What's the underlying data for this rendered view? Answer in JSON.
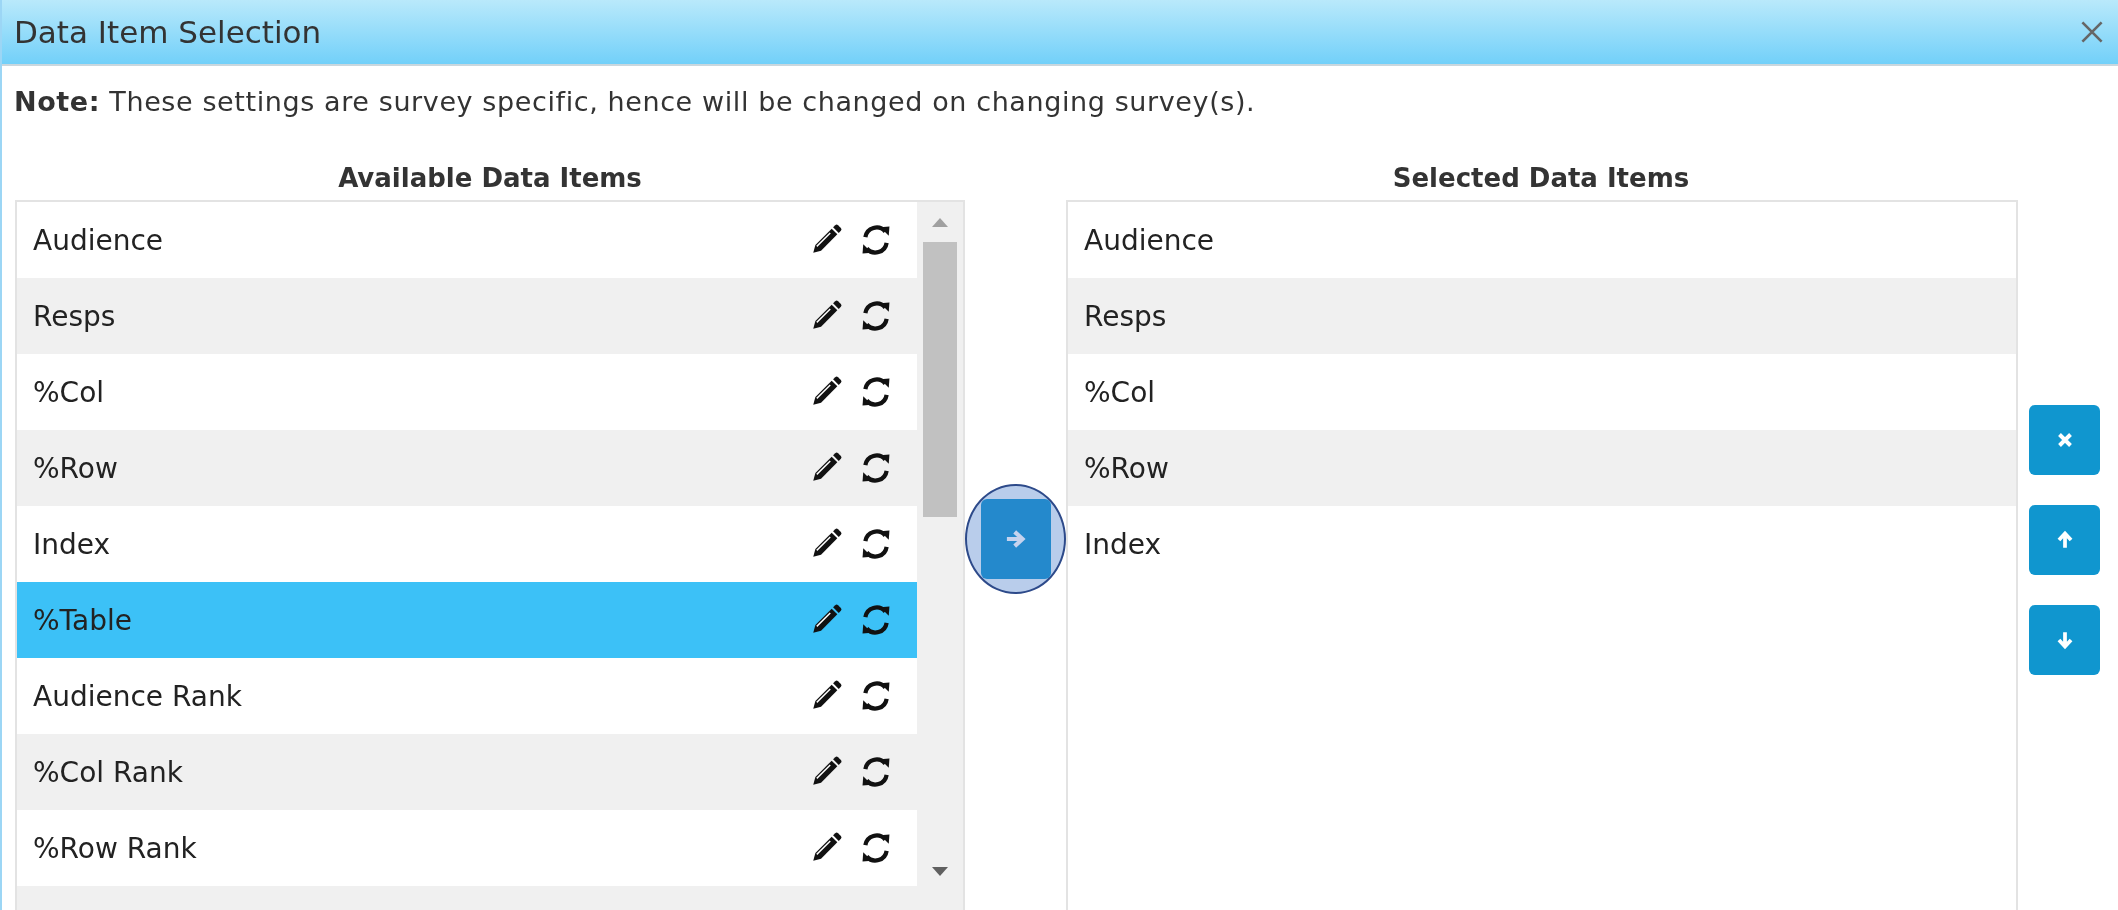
{
  "window": {
    "title": "Data Item Selection"
  },
  "note": "**Note:** These settings are survey specific, hence will be changed on changing survey(s).",
  "available": {
    "heading": "Available Data Items",
    "items": [
      {
        "label": "Audience",
        "selected": false
      },
      {
        "label": "Resps",
        "selected": false
      },
      {
        "label": "%Col",
        "selected": false
      },
      {
        "label": "%Row",
        "selected": false
      },
      {
        "label": "Index",
        "selected": false
      },
      {
        "label": "%Table",
        "selected": true
      },
      {
        "label": "Audience Rank",
        "selected": false
      },
      {
        "label": "%Col Rank",
        "selected": false
      },
      {
        "label": "%Row Rank",
        "selected": false
      }
    ]
  },
  "move_button": {
    "focused": true
  },
  "selected_list": {
    "heading": "Selected Data Items",
    "items": [
      {
        "label": "Audience",
        "selected": false
      },
      {
        "label": "Resps",
        "selected": false
      },
      {
        "label": "%Col",
        "selected": false
      },
      {
        "label": "%Row",
        "selected": false
      },
      {
        "label": "Index",
        "selected": false
      }
    ]
  },
  "side_buttons": [
    {
      "kind": "remove"
    },
    {
      "kind": "up"
    },
    {
      "kind": "down"
    }
  ]
}
